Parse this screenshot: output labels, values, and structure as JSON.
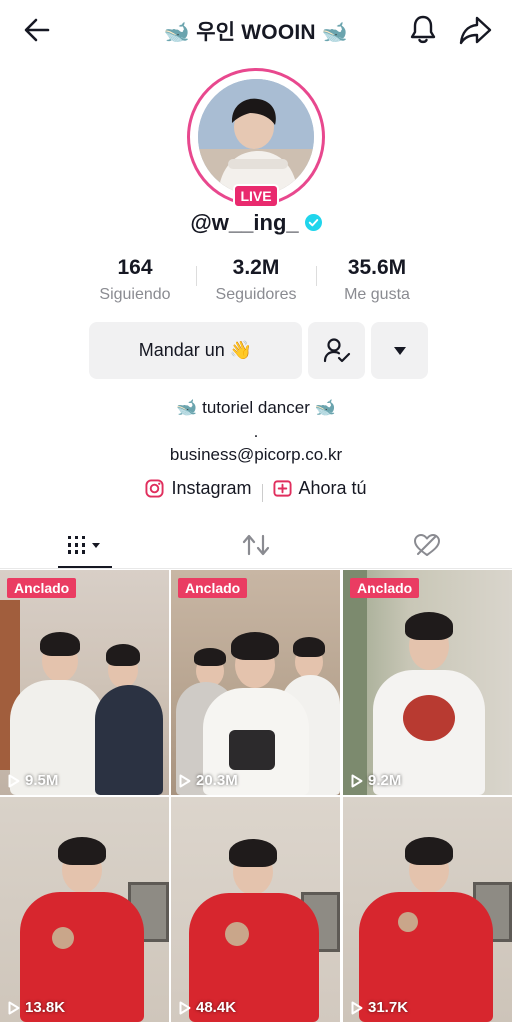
{
  "header": {
    "title": "🐋 우인 WOOIN 🐋"
  },
  "profile": {
    "live_label": "LIVE",
    "username": "@w__ing_"
  },
  "stats": [
    {
      "value": "164",
      "label": "Siguiendo"
    },
    {
      "value": "3.2M",
      "label": "Seguidores"
    },
    {
      "value": "35.6M",
      "label": "Me gusta"
    }
  ],
  "actions": {
    "message_label": "Mandar un 👋"
  },
  "bio": {
    "line1": "🐋 tutoriel dancer 🐋",
    "line2": ".",
    "line3": "business@picorp.co.kr"
  },
  "links": {
    "instagram": "Instagram",
    "ahora": "Ahora tú"
  },
  "grid": {
    "pinned_label": "Anclado",
    "videos": [
      {
        "views": "9.5M",
        "pinned": true
      },
      {
        "views": "20.3M",
        "pinned": true
      },
      {
        "views": "9.2M",
        "pinned": true
      },
      {
        "views": "13.8K",
        "pinned": false
      },
      {
        "views": "48.4K",
        "pinned": false
      },
      {
        "views": "31.7K",
        "pinned": false
      }
    ]
  },
  "colors": {
    "live": "#e92a6e",
    "pinned": "#ea3c62",
    "verified": "#20d5ec"
  }
}
